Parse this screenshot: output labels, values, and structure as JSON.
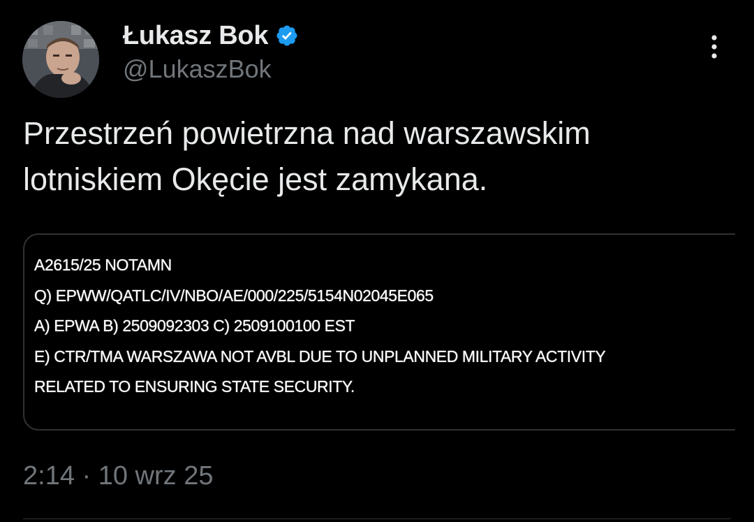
{
  "author": {
    "name": "Łukasz Bok",
    "handle": "@LukaszBok",
    "verified": true
  },
  "tweet": {
    "text_lines": [
      "Przestrzeń powietrzna nad warszawskim",
      "lotniskiem Okęcie jest zamykana."
    ],
    "media_text_lines": [
      "A2615/25 NOTAMN",
      "Q) EPWW/QATLC/IV/NBO/AE/000/225/5154N02045E065",
      "A) EPWA B) 2509092303 C) 2509100100 EST",
      "E) CTR/TMA WARSZAWA NOT AVBL DUE TO UNPLANNED MILITARY ACTIVITY",
      "RELATED TO ENSURING STATE SECURITY."
    ],
    "timestamp": "2:14 · 10 wrz 25"
  },
  "icons": {
    "verified": "verified-badge-icon",
    "more": "more-options-icon"
  },
  "colors": {
    "background": "#000000",
    "primary_text": "#e7e9ea",
    "secondary_text": "#71767b",
    "verified_blue": "#1d9bf0"
  }
}
